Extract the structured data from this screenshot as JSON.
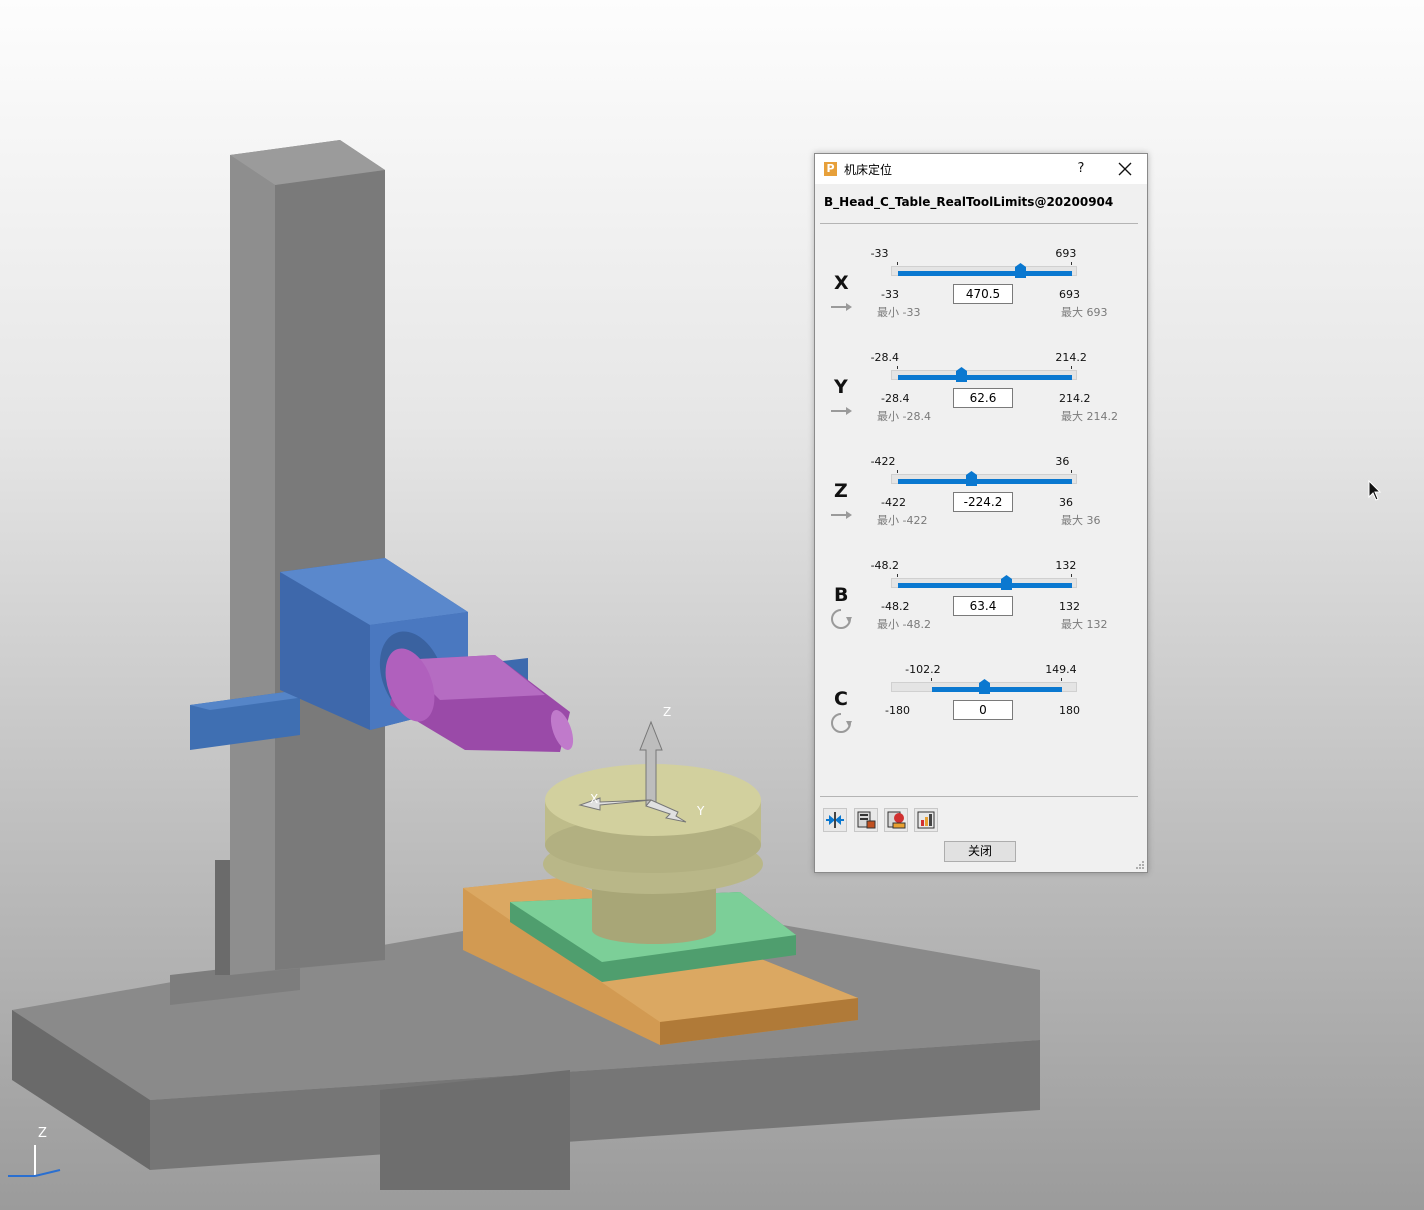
{
  "dialog": {
    "title": "机床定位",
    "help": "?",
    "machine_name": "B_Head_C_Table_RealToolLimits@20200904",
    "close_button": "关闭"
  },
  "axes": [
    {
      "name": "X",
      "kind": "linear",
      "range_min": "-33",
      "range_max": "693",
      "limit_min": "-33",
      "limit_max": "693",
      "min_note": "最小 -33",
      "max_note": "最大 693",
      "value": "470.5",
      "position_fraction": 0.692
    },
    {
      "name": "Y",
      "kind": "linear",
      "range_min": "-28.4",
      "range_max": "214.2",
      "limit_min": "-28.4",
      "limit_max": "214.2",
      "min_note": "最小 -28.4",
      "max_note": "最大 214.2",
      "value": "62.6",
      "position_fraction": 0.375
    },
    {
      "name": "Z",
      "kind": "linear",
      "range_min": "-422",
      "range_max": "36",
      "limit_min": "-422",
      "limit_max": "36",
      "min_note": "最小 -422",
      "max_note": "最大 36",
      "value": "-224.2",
      "position_fraction": 0.432
    },
    {
      "name": "B",
      "kind": "rotary",
      "range_min": "-48.2",
      "range_max": "132",
      "limit_min": "-48.2",
      "limit_max": "132",
      "min_note": "最小 -48.2",
      "max_note": "最大 132",
      "value": "63.4",
      "position_fraction": 0.619
    },
    {
      "name": "C",
      "kind": "rotary",
      "range_min": "-180",
      "range_max": "180",
      "limit_min": "-102.2",
      "limit_max": "149.4",
      "min_note": "",
      "max_note": "",
      "value": "0",
      "position_fraction": 0.5,
      "limit_min_fraction": 0.216,
      "limit_max_fraction": 0.915
    }
  ],
  "toolbar": [
    "align-to-tool-icon",
    "machine-settings-icon",
    "collision-check-icon",
    "report-icon"
  ],
  "viewport": {
    "world_triad": {
      "x": "X",
      "y": "Y",
      "z": "Z"
    },
    "corner_triad": {
      "z": "Z"
    }
  },
  "colors": {
    "accent": "#0a78d0",
    "head": "#4a78c0",
    "spindle": "#a050b0",
    "table": "#c9c797",
    "plate": "#5fbf85",
    "base_plate": "#c98a40"
  }
}
